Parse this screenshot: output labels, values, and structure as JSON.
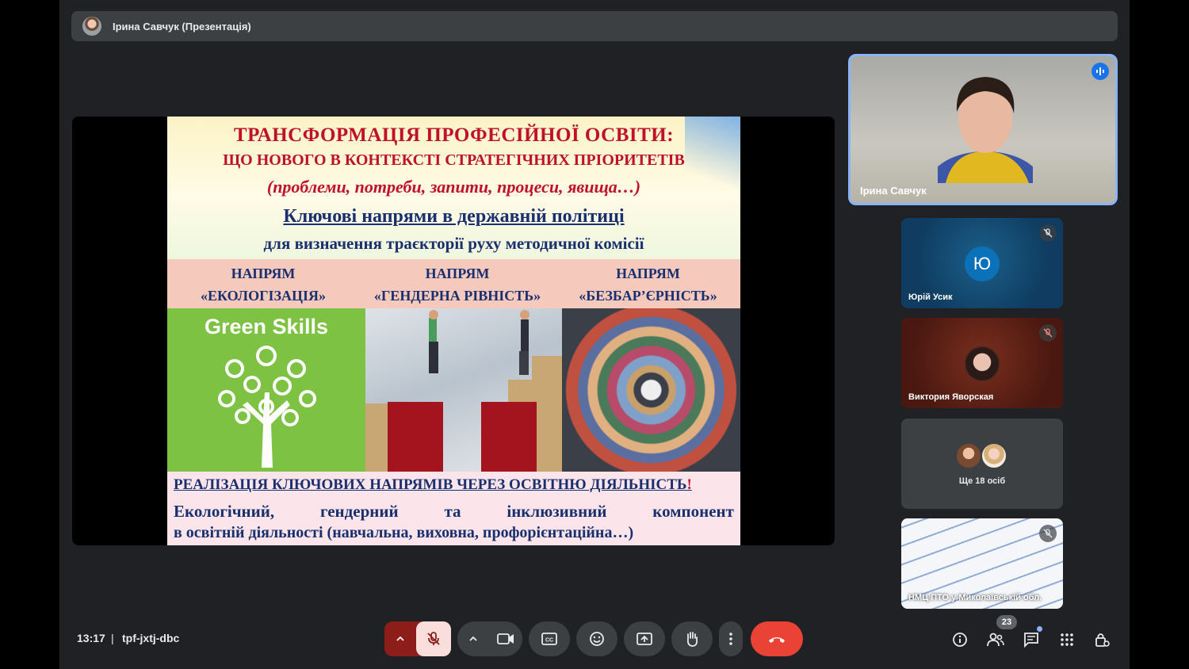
{
  "presenter": {
    "name": "Ірина Савчук (Презентація)"
  },
  "slide": {
    "title1": "ТРАНСФОРМАЦІЯ ПРОФЕСІЙНОЇ ОСВІТИ:",
    "title2": "ЩО НОВОГО В КОНТЕКСТІ СТРАТЕГІЧНИХ ПРІОРИТЕТІВ",
    "title3": "(проблеми, потреби, запити, процеси, явища…)",
    "title4": "Ключові напрями в державній політиці",
    "title5": "для визначення траєкторії руху методичної комісії",
    "directions": [
      {
        "line1": "НАПРЯМ",
        "line2": "«ЕКОЛОГІЗАЦІЯ»"
      },
      {
        "line1": "НАПРЯМ",
        "line2": "«ГЕНДЕРНА РІВНІСТЬ»"
      },
      {
        "line1": "НАПРЯМ",
        "line2": "«БЕЗБАР’ЄРНІСТЬ»"
      }
    ],
    "green_skills": "Green Skills",
    "bottom_title": "РЕАЛІЗАЦІЯ КЛЮЧОВИХ НАПРЯМІВ ЧЕРЕЗ ОСВІТНЮ ДІЯЛЬНІСТЬ",
    "bottom_excl": "!",
    "bottom_words": [
      "Екологічний,",
      "гендерний",
      "та",
      "інклюзивний",
      "компонент"
    ],
    "bottom_line2": "в освітній діяльності (навчальна, виховна, профорієнтаційна…)"
  },
  "participants": {
    "main": {
      "name": "Ірина Савчук"
    },
    "tiles": [
      {
        "name": "Юрій Усик",
        "initial": "Ю"
      },
      {
        "name": "Виктория Яворская"
      },
      {
        "more_label": "Ще 18 осіб"
      },
      {
        "name": "НМЦ ПТО у Миколаївській обл."
      }
    ]
  },
  "meeting": {
    "time": "13:17",
    "separator": "|",
    "code": "tpf-jxtj-dbc",
    "people_count": "23"
  },
  "colors": {
    "accent": "#8ab4f8",
    "end_call": "#ea4335",
    "mic_off_bg": "#f9dedc",
    "mic_group": "#8c1d18",
    "bar": "#3c4043"
  }
}
